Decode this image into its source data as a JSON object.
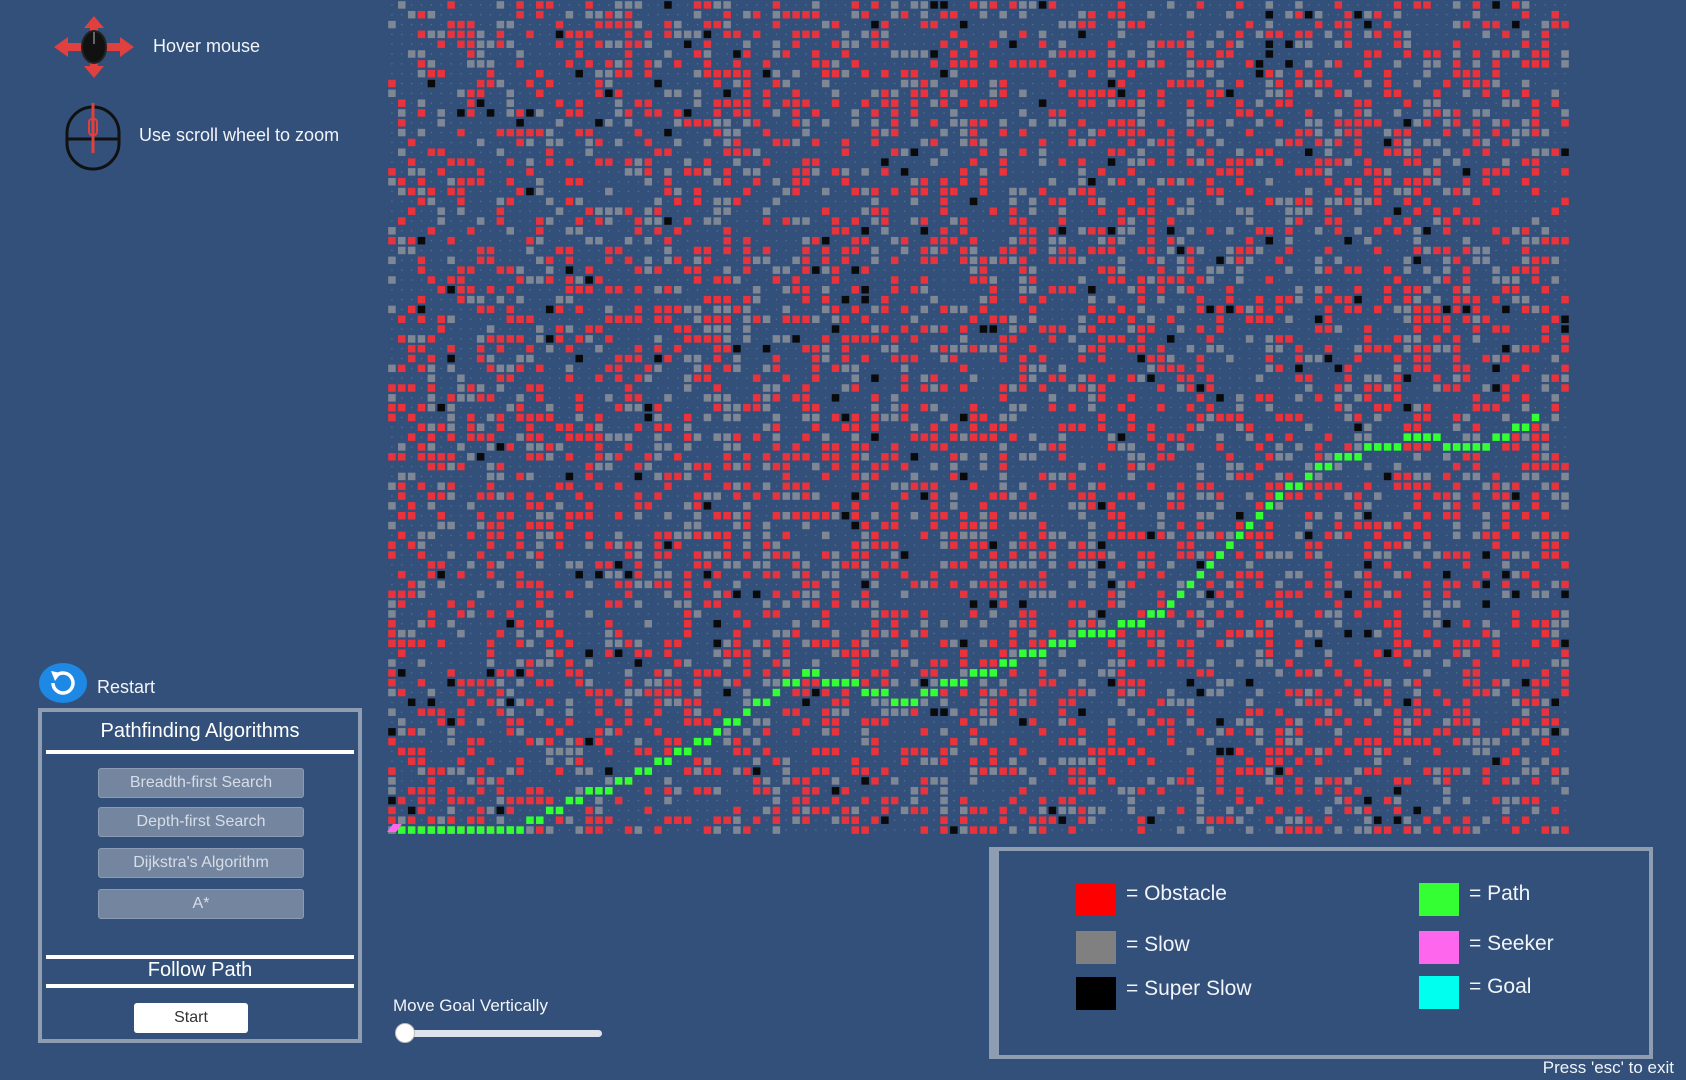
{
  "hints": {
    "hover": "Hover mouse",
    "zoom": "Use scroll wheel to zoom",
    "icons": [
      "mouse-move-arrows-icon",
      "mouse-scroll-icon"
    ]
  },
  "restart": {
    "label": "Restart",
    "icon": "restart-icon"
  },
  "algorithms_panel": {
    "title": "Pathfinding Algorithms",
    "buttons": [
      "Breadth-first Search",
      "Depth-first Search",
      "Dijkstra's Algorithm",
      "A*"
    ],
    "follow_title": "Follow Path",
    "start_label": "Start"
  },
  "slider": {
    "label": "Move Goal Vertically",
    "value": 0
  },
  "legend": {
    "items": [
      {
        "label": "= Obstacle",
        "color": "#ff0000"
      },
      {
        "label": "= Slow",
        "color": "#808080"
      },
      {
        "label": "= Super Slow",
        "color": "#000000"
      },
      {
        "label": "= Path",
        "color": "#33ff33"
      },
      {
        "label": "= Seeker",
        "color": "#ff66ee"
      },
      {
        "label": "= Goal",
        "color": "#00ffee"
      }
    ]
  },
  "grid": {
    "background": "#32507a",
    "dot_color": "#5a7699",
    "cell_colors": {
      "obstacle": "#e8323c",
      "slow": "#7f8795",
      "super_slow": "#0a0a0a",
      "path": "#33ff33",
      "seeker": "#ff66ee"
    }
  },
  "exit_hint": "Press 'esc' to exit"
}
